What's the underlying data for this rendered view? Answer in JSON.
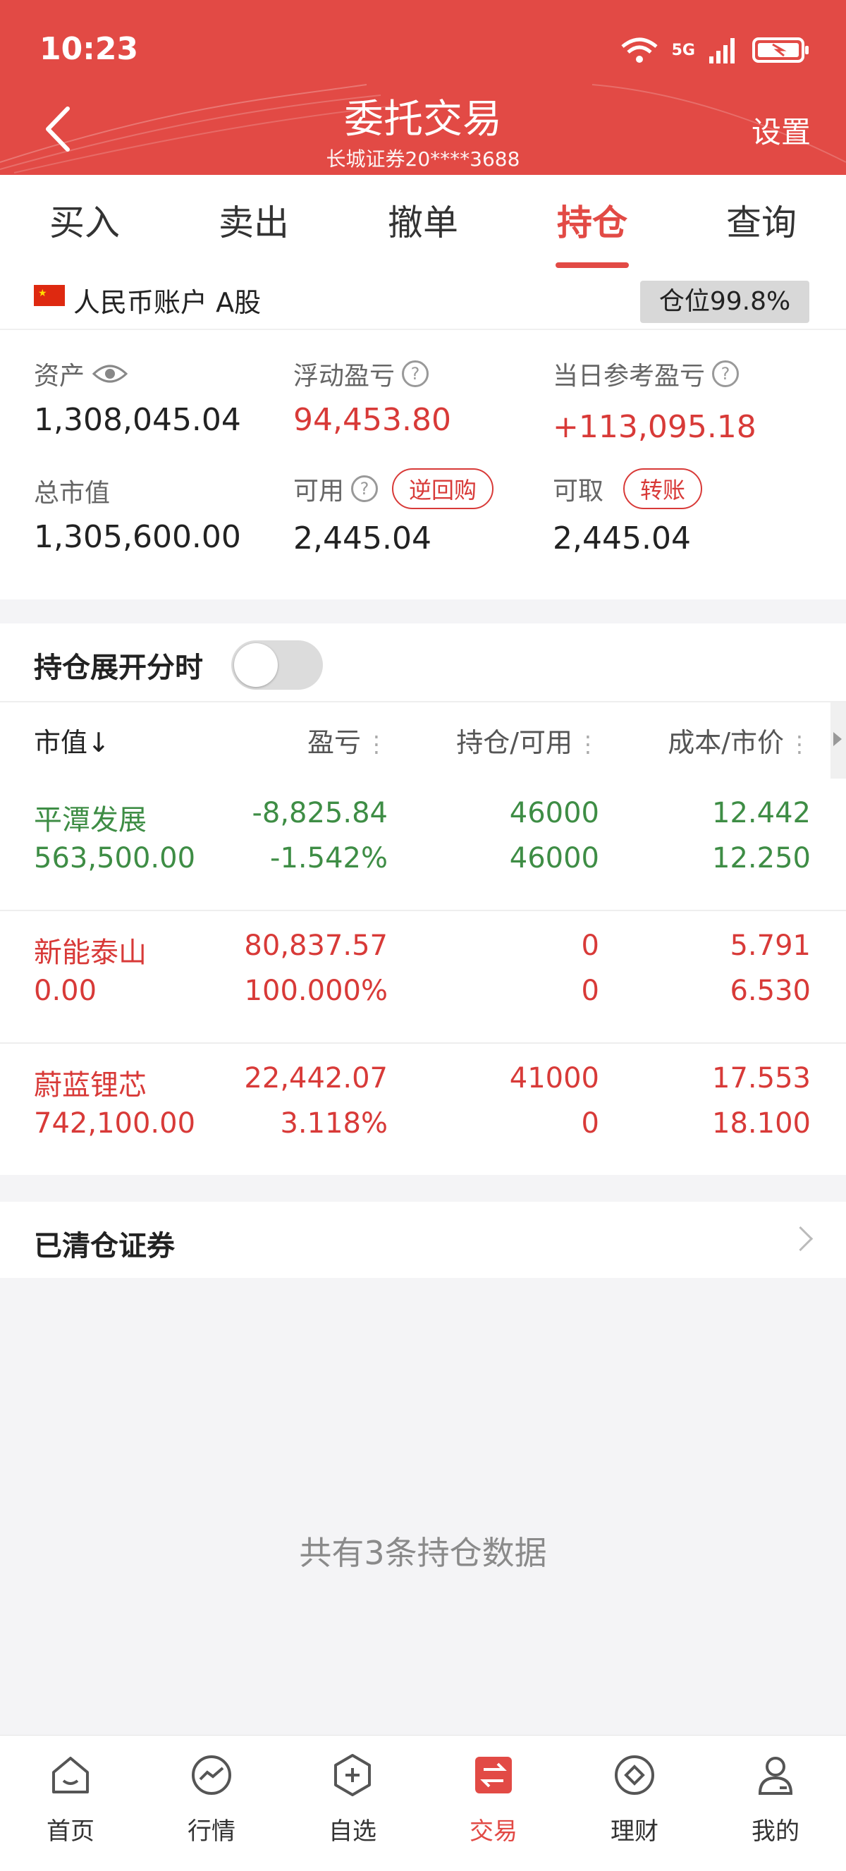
{
  "status": {
    "time": "10:23",
    "network": "5G"
  },
  "header": {
    "title": "委托交易",
    "subtitle": "长城证券20****3688",
    "settings": "设置"
  },
  "tabs": [
    {
      "label": "买入"
    },
    {
      "label": "卖出"
    },
    {
      "label": "撤单"
    },
    {
      "label": "持仓",
      "active": true
    },
    {
      "label": "查询"
    }
  ],
  "account": {
    "label": "人民币账户 A股",
    "position_pct": "仓位99.8%"
  },
  "summary": {
    "assets_label": "资产",
    "assets": "1,308,045.04",
    "floating_pl_label": "浮动盈亏",
    "floating_pl": "94,453.80",
    "daily_pl_label": "当日参考盈亏",
    "daily_pl": "+113,095.18",
    "market_value_label": "总市值",
    "market_value": "1,305,600.00",
    "available_label": "可用",
    "available": "2,445.04",
    "reverse_repo": "逆回购",
    "withdrawable_label": "可取",
    "withdrawable": "2,445.04",
    "transfer": "转账"
  },
  "toggle": {
    "label": "持仓展开分时",
    "on": false
  },
  "table": {
    "headers": [
      "市值↓",
      "盈亏",
      "持仓/可用",
      "成本/市价"
    ],
    "rows": [
      {
        "name": "平潭发展",
        "mv": "563,500.00",
        "pl": "-8,825.84",
        "pl_pct": "-1.542%",
        "hold": "46000",
        "avail": "46000",
        "cost": "12.442",
        "price": "12.250",
        "color": "#3e8d45"
      },
      {
        "name": "新能泰山",
        "mv": "0.00",
        "pl": "80,837.57",
        "pl_pct": "100.000%",
        "hold": "0",
        "avail": "0",
        "cost": "5.791",
        "price": "6.530",
        "color": "#d83a38"
      },
      {
        "name": "蔚蓝锂芯",
        "mv": "742,100.00",
        "pl": "22,442.07",
        "pl_pct": "3.118%",
        "hold": "41000",
        "avail": "0",
        "cost": "17.553",
        "price": "18.100",
        "color": "#d83a38"
      }
    ]
  },
  "cleared": {
    "label": "已清仓证券"
  },
  "footer_note": "共有3条持仓数据",
  "nav": [
    {
      "label": "首页",
      "icon": "home-icon"
    },
    {
      "label": "行情",
      "icon": "market-icon"
    },
    {
      "label": "自选",
      "icon": "watchlist-icon"
    },
    {
      "label": "交易",
      "icon": "trade-icon",
      "active": true
    },
    {
      "label": "理财",
      "icon": "wealth-icon"
    },
    {
      "label": "我的",
      "icon": "profile-icon"
    }
  ]
}
